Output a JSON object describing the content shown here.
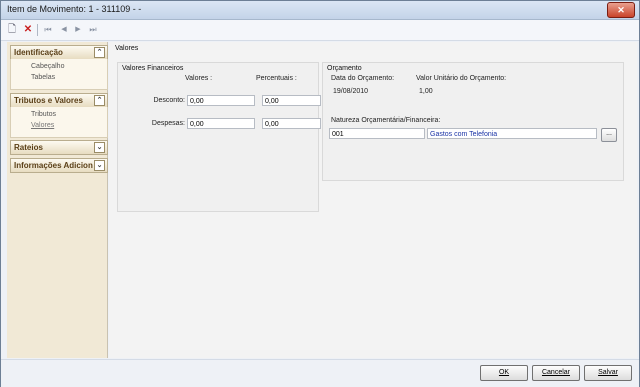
{
  "window": {
    "title": "Item de Movimento: 1 - 311109 -  -",
    "close_glyph": "✕"
  },
  "toolbar": {
    "new_icon": "new-document-icon",
    "delete_icon": "delete-icon",
    "first_icon": "first-record-icon",
    "prev_icon": "previous-record-icon",
    "next_icon": "next-record-icon",
    "last_icon": "last-record-icon",
    "new_glyph": "🗋",
    "delete_glyph": "✕",
    "first_glyph": "⏮",
    "prev_glyph": "◀",
    "next_glyph": "▶",
    "last_glyph": "⏭"
  },
  "sidebar": {
    "groups": [
      {
        "title": "Identificação",
        "toggle": "⌃",
        "items": [
          "Cabeçalho",
          "Tabelas"
        ]
      },
      {
        "title": "Tributos e Valores",
        "toggle": "⌃",
        "items": [
          "Tributos",
          "Valores"
        ]
      },
      {
        "title": "Rateios",
        "toggle": "⌄",
        "items": []
      },
      {
        "title": "Informações Adicion",
        "toggle": "⌄",
        "items": []
      }
    ]
  },
  "main": {
    "section_title": "Valores",
    "financeiros": {
      "title": "Valores Financeiros",
      "col_valores": "Valores :",
      "col_percentuais": "Percentuais :",
      "rows": [
        {
          "label": "Desconto:",
          "valor": "0,00",
          "percentual": "0,00"
        },
        {
          "label": "Despesas:",
          "valor": "0,00",
          "percentual": "0,00"
        }
      ]
    },
    "orcamento": {
      "title": "Orçamento",
      "data_label": "Data do Orçamento:",
      "data_value": "19/08/2010",
      "valor_label": "Valor Unitário do Orçamento:",
      "valor_value": "1,00",
      "natureza_label": "Natureza Orçamentária/Financeira:",
      "natureza_code": "001",
      "natureza_desc": "Gastos com Telefonia",
      "lookup_label": "..."
    }
  },
  "footer": {
    "ok": "OK",
    "cancelar": "Cancelar",
    "salvar": "Salvar"
  },
  "colors": {
    "accent_blue": "#1a33a6",
    "sidebar_bg": "#f1e9d6",
    "group_header_text": "#5a3f17"
  }
}
